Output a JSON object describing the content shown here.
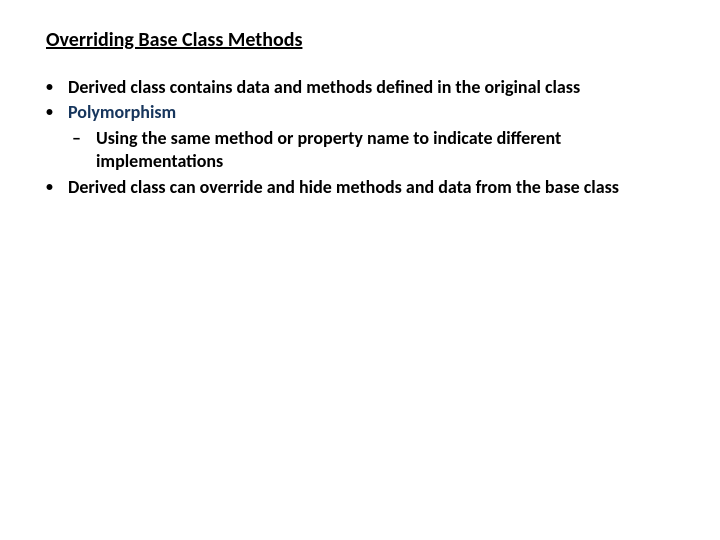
{
  "title": "Overriding Base Class Methods",
  "bullets": {
    "b1": "Derived class contains data and methods defined in the original class",
    "b2": "Polymorphism",
    "b2_sub1": "Using the same method or property name to indicate different implementations",
    "b3": "Derived class can override and hide methods and data from the base class"
  }
}
